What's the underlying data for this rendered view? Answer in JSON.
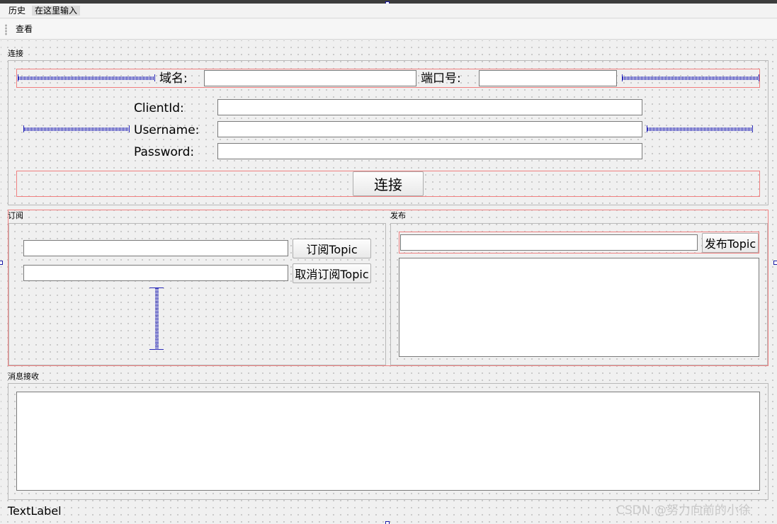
{
  "menubar": {
    "items": [
      "历史",
      "在这里输入"
    ]
  },
  "toolbar": {
    "view_label": "查看"
  },
  "connect_group": {
    "title": "连接",
    "domain_label": "域名:",
    "domain_value": "",
    "port_label": "端口号:",
    "port_value": "",
    "client_id_label": "ClientId:",
    "client_id_value": "",
    "username_label": "Username:",
    "username_value": "",
    "password_label": "Password:",
    "password_value": "",
    "connect_button": "连接"
  },
  "subscribe_group": {
    "title": "订阅",
    "topic_input_value": "",
    "unsub_input_value": "",
    "subscribe_button": "订阅Topic",
    "unsubscribe_button": "取消订阅Topic"
  },
  "publish_group": {
    "title": "发布",
    "topic_input_value": "",
    "publish_button": "发布Topic",
    "message_text": ""
  },
  "receive_group": {
    "title": "消息接收",
    "received_text": ""
  },
  "status": {
    "text_label": "TextLabel"
  },
  "watermark": "CSDN @努力向前的小徐",
  "colors": {
    "layout_border": "#f08080",
    "spacer": "#2a2ab8",
    "selection_handle": "#1a1aa8"
  }
}
